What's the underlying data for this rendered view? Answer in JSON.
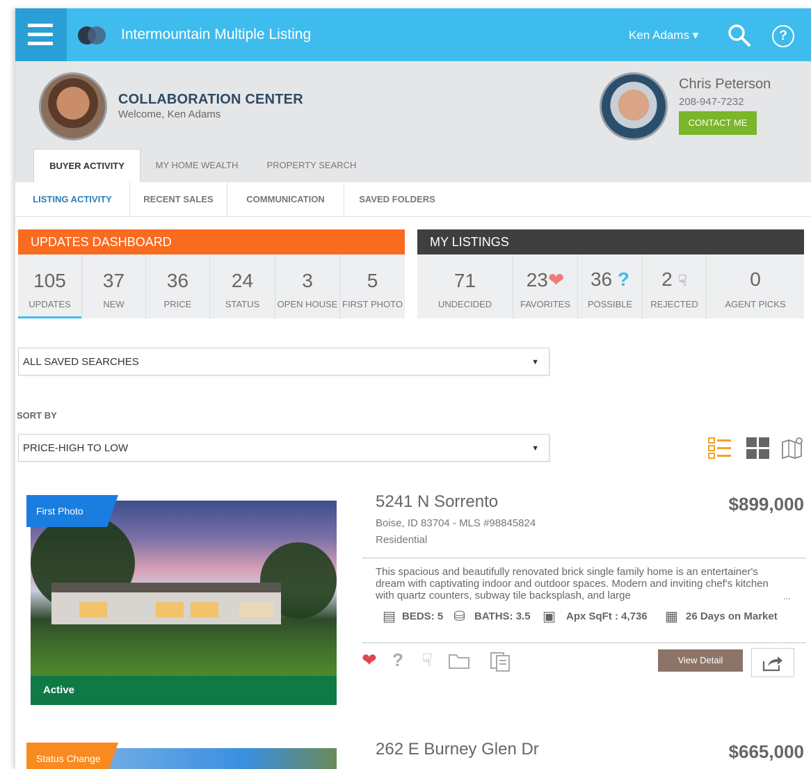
{
  "app": {
    "title": "Intermountain Multiple Listing"
  },
  "user_menu": {
    "label": "Ken Adams ▾"
  },
  "header": {
    "title": "COLLABORATION CENTER",
    "welcome": "Welcome, Ken Adams",
    "agent": {
      "name": "Chris Peterson",
      "phone": "208-947-7232",
      "contact_label": "CONTACT ME"
    }
  },
  "main_tabs": [
    {
      "label": "BUYER ACTIVITY",
      "active": true
    },
    {
      "label": "MY HOME WEALTH"
    },
    {
      "label": "PROPERTY SEARCH"
    }
  ],
  "sub_tabs": [
    {
      "label": "LISTING ACTIVITY",
      "active": true
    },
    {
      "label": "RECENT SALES"
    },
    {
      "label": "COMMUNICATION"
    },
    {
      "label": "SAVED FOLDERS"
    }
  ],
  "updates_dashboard": {
    "title": "UPDATES DASHBOARD",
    "stats": [
      {
        "value": "105",
        "label": "UPDATES"
      },
      {
        "value": "37",
        "label": "NEW"
      },
      {
        "value": "36",
        "label": "PRICE"
      },
      {
        "value": "24",
        "label": "STATUS"
      },
      {
        "value": "3",
        "label": "OPEN HOUSE"
      },
      {
        "value": "5",
        "label": "FIRST PHOTO"
      }
    ]
  },
  "my_listings": {
    "title": "MY LISTINGS",
    "stats": [
      {
        "value": "71",
        "label": "UNDECIDED"
      },
      {
        "value": "23",
        "label": "FAVORITES"
      },
      {
        "value": "36",
        "label": "POSSIBLE"
      },
      {
        "value": "2",
        "label": "REJECTED"
      },
      {
        "value": "0",
        "label": "AGENT PICKS"
      }
    ]
  },
  "saved_searches": {
    "value": "ALL SAVED SEARCHES"
  },
  "sort": {
    "label": "SORT BY",
    "value": "PRICE-HIGH TO LOW"
  },
  "listings": [
    {
      "ribbon": "First Photo",
      "status": "Active",
      "address": "5241 N Sorrento",
      "price": "$899,000",
      "location": "Boise, ID 83704 - MLS #98845824",
      "type": "Residential",
      "description": "This spacious and beautifully renovated brick single family home is an entertainer's dream with captivating indoor and outdoor spaces. Modern and inviting chef's kitchen with quartz counters, subway tile backsplash, and large",
      "ellipsis": "...",
      "beds": "BEDS: 5",
      "baths": "BATHS: 3.5",
      "sqft": "Apx SqFt : 4,736",
      "dom": "26 Days on Market",
      "view_detail_label": "View Detail"
    },
    {
      "ribbon": "Status Change",
      "address": "262 E Burney Glen Dr",
      "price": "$665,000"
    }
  ],
  "colors": {
    "topbar": "#3ebced",
    "updates_header": "#fa6a1f",
    "listings_header": "#3f3f3f",
    "contact_button": "#7ab629",
    "active_status": "#0f7a45"
  }
}
